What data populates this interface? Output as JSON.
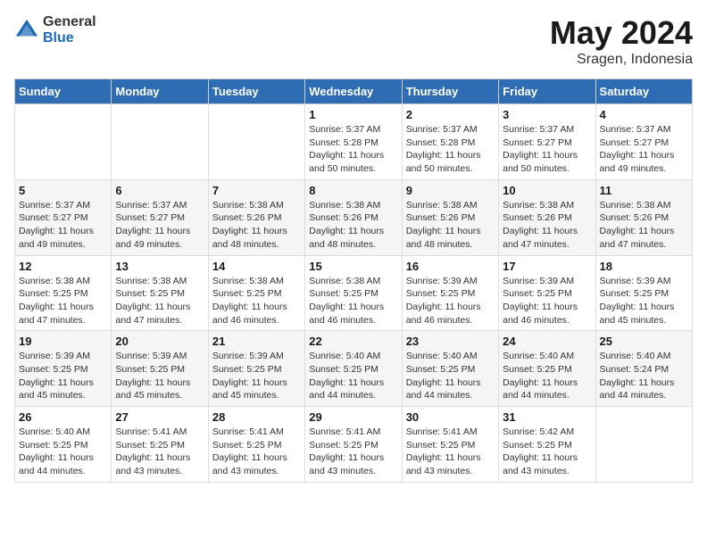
{
  "logo": {
    "general": "General",
    "blue": "Blue"
  },
  "title": "May 2024",
  "subtitle": "Sragen, Indonesia",
  "days_of_week": [
    "Sunday",
    "Monday",
    "Tuesday",
    "Wednesday",
    "Thursday",
    "Friday",
    "Saturday"
  ],
  "weeks": [
    [
      {
        "day": "",
        "info": ""
      },
      {
        "day": "",
        "info": ""
      },
      {
        "day": "",
        "info": ""
      },
      {
        "day": "1",
        "info": "Sunrise: 5:37 AM\nSunset: 5:28 PM\nDaylight: 11 hours\nand 50 minutes."
      },
      {
        "day": "2",
        "info": "Sunrise: 5:37 AM\nSunset: 5:28 PM\nDaylight: 11 hours\nand 50 minutes."
      },
      {
        "day": "3",
        "info": "Sunrise: 5:37 AM\nSunset: 5:27 PM\nDaylight: 11 hours\nand 50 minutes."
      },
      {
        "day": "4",
        "info": "Sunrise: 5:37 AM\nSunset: 5:27 PM\nDaylight: 11 hours\nand 49 minutes."
      }
    ],
    [
      {
        "day": "5",
        "info": "Sunrise: 5:37 AM\nSunset: 5:27 PM\nDaylight: 11 hours\nand 49 minutes."
      },
      {
        "day": "6",
        "info": "Sunrise: 5:37 AM\nSunset: 5:27 PM\nDaylight: 11 hours\nand 49 minutes."
      },
      {
        "day": "7",
        "info": "Sunrise: 5:38 AM\nSunset: 5:26 PM\nDaylight: 11 hours\nand 48 minutes."
      },
      {
        "day": "8",
        "info": "Sunrise: 5:38 AM\nSunset: 5:26 PM\nDaylight: 11 hours\nand 48 minutes."
      },
      {
        "day": "9",
        "info": "Sunrise: 5:38 AM\nSunset: 5:26 PM\nDaylight: 11 hours\nand 48 minutes."
      },
      {
        "day": "10",
        "info": "Sunrise: 5:38 AM\nSunset: 5:26 PM\nDaylight: 11 hours\nand 47 minutes."
      },
      {
        "day": "11",
        "info": "Sunrise: 5:38 AM\nSunset: 5:26 PM\nDaylight: 11 hours\nand 47 minutes."
      }
    ],
    [
      {
        "day": "12",
        "info": "Sunrise: 5:38 AM\nSunset: 5:25 PM\nDaylight: 11 hours\nand 47 minutes."
      },
      {
        "day": "13",
        "info": "Sunrise: 5:38 AM\nSunset: 5:25 PM\nDaylight: 11 hours\nand 47 minutes."
      },
      {
        "day": "14",
        "info": "Sunrise: 5:38 AM\nSunset: 5:25 PM\nDaylight: 11 hours\nand 46 minutes."
      },
      {
        "day": "15",
        "info": "Sunrise: 5:38 AM\nSunset: 5:25 PM\nDaylight: 11 hours\nand 46 minutes."
      },
      {
        "day": "16",
        "info": "Sunrise: 5:39 AM\nSunset: 5:25 PM\nDaylight: 11 hours\nand 46 minutes."
      },
      {
        "day": "17",
        "info": "Sunrise: 5:39 AM\nSunset: 5:25 PM\nDaylight: 11 hours\nand 46 minutes."
      },
      {
        "day": "18",
        "info": "Sunrise: 5:39 AM\nSunset: 5:25 PM\nDaylight: 11 hours\nand 45 minutes."
      }
    ],
    [
      {
        "day": "19",
        "info": "Sunrise: 5:39 AM\nSunset: 5:25 PM\nDaylight: 11 hours\nand 45 minutes."
      },
      {
        "day": "20",
        "info": "Sunrise: 5:39 AM\nSunset: 5:25 PM\nDaylight: 11 hours\nand 45 minutes."
      },
      {
        "day": "21",
        "info": "Sunrise: 5:39 AM\nSunset: 5:25 PM\nDaylight: 11 hours\nand 45 minutes."
      },
      {
        "day": "22",
        "info": "Sunrise: 5:40 AM\nSunset: 5:25 PM\nDaylight: 11 hours\nand 44 minutes."
      },
      {
        "day": "23",
        "info": "Sunrise: 5:40 AM\nSunset: 5:25 PM\nDaylight: 11 hours\nand 44 minutes."
      },
      {
        "day": "24",
        "info": "Sunrise: 5:40 AM\nSunset: 5:25 PM\nDaylight: 11 hours\nand 44 minutes."
      },
      {
        "day": "25",
        "info": "Sunrise: 5:40 AM\nSunset: 5:24 PM\nDaylight: 11 hours\nand 44 minutes."
      }
    ],
    [
      {
        "day": "26",
        "info": "Sunrise: 5:40 AM\nSunset: 5:25 PM\nDaylight: 11 hours\nand 44 minutes."
      },
      {
        "day": "27",
        "info": "Sunrise: 5:41 AM\nSunset: 5:25 PM\nDaylight: 11 hours\nand 43 minutes."
      },
      {
        "day": "28",
        "info": "Sunrise: 5:41 AM\nSunset: 5:25 PM\nDaylight: 11 hours\nand 43 minutes."
      },
      {
        "day": "29",
        "info": "Sunrise: 5:41 AM\nSunset: 5:25 PM\nDaylight: 11 hours\nand 43 minutes."
      },
      {
        "day": "30",
        "info": "Sunrise: 5:41 AM\nSunset: 5:25 PM\nDaylight: 11 hours\nand 43 minutes."
      },
      {
        "day": "31",
        "info": "Sunrise: 5:42 AM\nSunset: 5:25 PM\nDaylight: 11 hours\nand 43 minutes."
      },
      {
        "day": "",
        "info": ""
      }
    ]
  ]
}
